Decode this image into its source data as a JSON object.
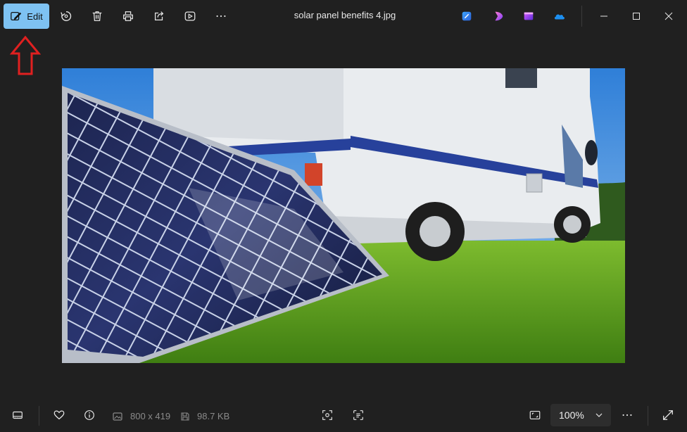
{
  "toolbar": {
    "edit_label": "Edit",
    "icons": [
      "edit-icon",
      "rotate-icon",
      "delete-icon",
      "print-icon",
      "share-icon",
      "slideshow-icon",
      "more-icon"
    ]
  },
  "window": {
    "title": "solar panel benefits 4.jpg"
  },
  "apps": [
    "designer-icon",
    "clipchamp-icon",
    "video-editor-icon",
    "onedrive-icon"
  ],
  "bottom": {
    "dimensions": "800 x 419",
    "file_size": "98.7 KB",
    "zoom": "100%"
  },
  "colors": {
    "accent": "#7ec2f2",
    "annotation_arrow": "#e02020"
  }
}
